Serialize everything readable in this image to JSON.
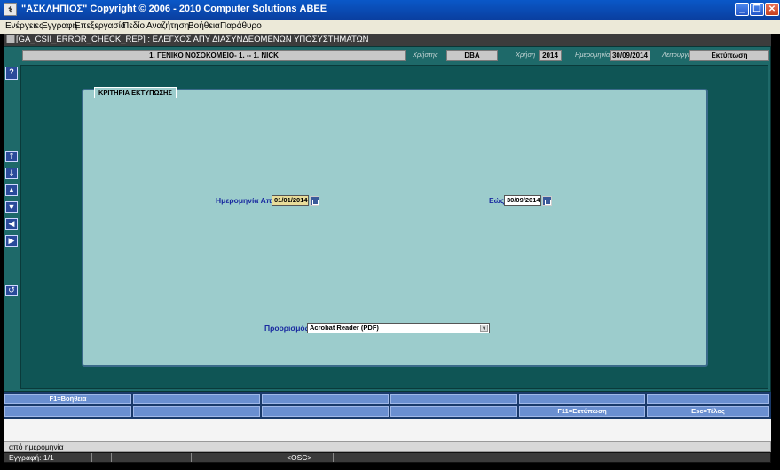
{
  "window": {
    "title": "\"ΑΣΚΛΗΠΙΟΣ\" Copyright © 2006 - 2010 Computer Solutions ΑΒΕΕ"
  },
  "menu": [
    "Ενέργειες",
    "Εγγραφή",
    "Επεξεργασία",
    "Πεδίο",
    "Αναζήτηση",
    "Βοήθεια",
    "Παράθυρο"
  ],
  "form": {
    "title": "[GA_CSII_ERROR_CHECK_REP]  :  ΕΛΕΓΧΟΣ ΑΠΥ ΔΙΑΣΥΝΔΕΟΜΕΝΩΝ ΥΠΟΣΥΣΤΗΜΑΤΩΝ"
  },
  "info": {
    "hospital": "1. ΓΕΝΙΚΟ ΝΟΣΟΚΟΜΕΙΟ- 1. -- 1. NICK",
    "user_label": "Χρήστης",
    "user": "DBA",
    "year_label": "Χρήση",
    "year": "2014",
    "date_label": "Ημερομηνία",
    "date": "30/09/2014",
    "mode_label": "Λειτουργία",
    "mode": "Εκτύπωση"
  },
  "help_btn": "?",
  "panel": {
    "caption": "ΚΡΙΤΗΡΙΑ ΕΚΤΥΠΩΣΗΣ",
    "date_from_label": "Ημερομηνία Από",
    "date_from": "01/01/2014",
    "date_to_label": "Εώς",
    "date_to": "30/09/2014",
    "destination_label": "Προορισμός",
    "destination": "Acrobat Reader (PDF)"
  },
  "nav_icons": [
    "first-record-icon",
    "last-record-icon",
    "previous-record-icon",
    "next-record-icon",
    "previous-block-icon",
    "next-block-icon",
    "return-icon"
  ],
  "fkeys_row1": [
    "F1=Βοήθεια",
    "",
    "",
    "",
    "",
    "",
    ""
  ],
  "fkeys_row2": [
    "",
    "",
    "",
    "",
    "",
    "F11=Εκτύπωση",
    "Esc=Τέλος"
  ],
  "status": {
    "hint": "από ημερομηνία",
    "record": "Εγγραφή: 1/1",
    "osc": "<OSC>"
  }
}
